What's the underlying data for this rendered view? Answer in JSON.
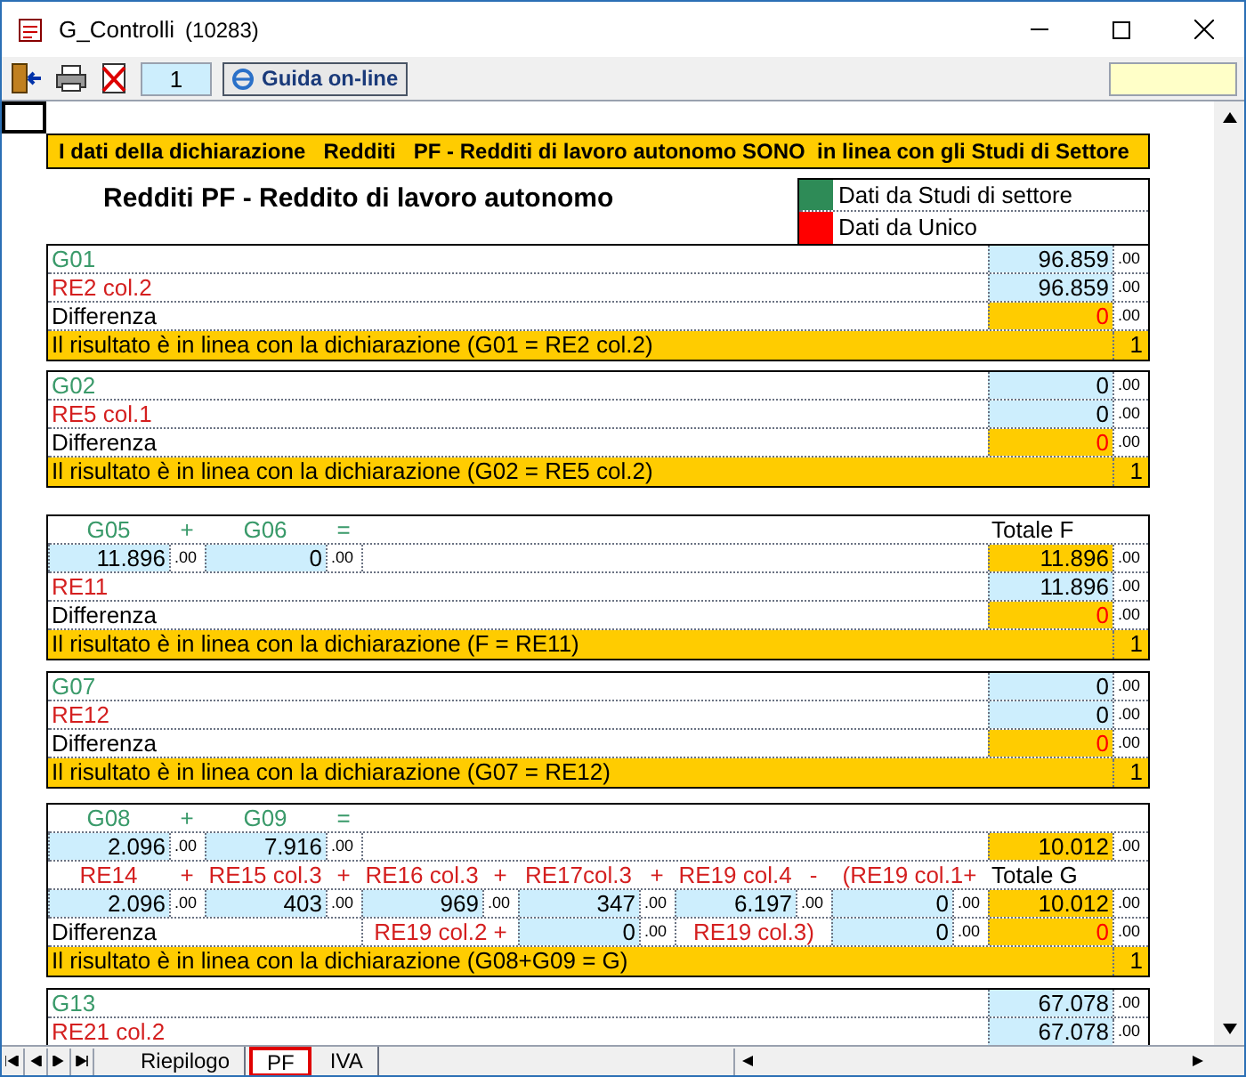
{
  "window": {
    "title": "G_Controlli",
    "code": "(10283)"
  },
  "toolbar": {
    "page_field": "1",
    "help_button": "Guida on-line"
  },
  "banner": "I dati della dichiarazione   Redditi   PF - Redditi di lavoro autonomo SONO  in linea con gli Studi di Settore",
  "heading": "Redditi PF -  Reddito di lavoro autonomo",
  "legend": [
    {
      "label": "Dati da Studi di settore",
      "color": "#2e8b57"
    },
    {
      "label": "Dati da Unico",
      "color": "#ff0000"
    }
  ],
  "blocks": [
    {
      "rows": [
        {
          "kind": "line",
          "label": "G01",
          "color": "#3a9a6a",
          "value": {
            "v": "96.859",
            "d": ".00",
            "computed": false
          }
        },
        {
          "kind": "line",
          "label": "RE2 col.2",
          "color": "#d41f1f",
          "value": {
            "v": "96.859",
            "d": ".00",
            "computed": false
          }
        },
        {
          "kind": "difference",
          "label": "Differenza",
          "value": {
            "v": "0",
            "d": ".00",
            "computed": true
          }
        },
        {
          "kind": "result",
          "text": "Il risultato è in linea con la dichiarazione (G01 = RE2 col.2)",
          "flag": "1"
        }
      ]
    },
    {
      "rows": [
        {
          "kind": "line",
          "label": "G02",
          "color": "#3a9a6a",
          "value": {
            "v": "0",
            "d": ".00",
            "computed": false
          }
        },
        {
          "kind": "line",
          "label": "RE5 col.1",
          "color": "#d41f1f",
          "value": {
            "v": "0",
            "d": ".00",
            "computed": false
          }
        },
        {
          "kind": "difference",
          "label": "Differenza",
          "value": {
            "v": "0",
            "d": ".00",
            "computed": true
          }
        },
        {
          "kind": "result",
          "text": "Il risultato è in linea con la dichiarazione (G02 = RE5 col.2)",
          "flag": "1"
        }
      ]
    },
    {
      "rows": [
        {
          "kind": "terms",
          "color": "#3a9a6a",
          "items": [
            "G05",
            "+",
            "G06",
            "="
          ],
          "total_label": "Totale F"
        },
        {
          "kind": "values",
          "cells": [
            {
              "v": "11.896",
              "d": ".00",
              "computed": false
            },
            {
              "v": "0",
              "d": ".00",
              "computed": false
            }
          ],
          "total": {
            "v": "11.896",
            "d": ".00",
            "computed": true
          }
        },
        {
          "kind": "line",
          "label": "RE11",
          "color": "#d41f1f",
          "value": {
            "v": "11.896",
            "d": ".00",
            "computed": false
          }
        },
        {
          "kind": "difference",
          "label": "Differenza",
          "value": {
            "v": "0",
            "d": ".00",
            "computed": true
          }
        },
        {
          "kind": "result",
          "text": "Il risultato è in linea con la dichiarazione (F = RE11)",
          "flag": "1"
        }
      ]
    },
    {
      "rows": [
        {
          "kind": "line",
          "label": "G07",
          "color": "#3a9a6a",
          "value": {
            "v": "0",
            "d": ".00",
            "computed": false
          }
        },
        {
          "kind": "line",
          "label": "RE12",
          "color": "#d41f1f",
          "value": {
            "v": "0",
            "d": ".00",
            "computed": false
          }
        },
        {
          "kind": "difference",
          "label": "Differenza",
          "value": {
            "v": "0",
            "d": ".00",
            "computed": true
          }
        },
        {
          "kind": "result",
          "text": "Il risultato è in linea con la dichiarazione (G07 = RE12)",
          "flag": "1"
        }
      ]
    },
    {
      "rows": [
        {
          "kind": "terms",
          "color": "#3a9a6a",
          "items": [
            "G08",
            "+",
            "G09",
            "="
          ]
        },
        {
          "kind": "values",
          "cells": [
            {
              "v": "2.096",
              "d": ".00",
              "computed": false
            },
            {
              "v": "7.916",
              "d": ".00",
              "computed": false
            }
          ],
          "total": {
            "v": "10.012",
            "d": ".00",
            "computed": true
          }
        },
        {
          "kind": "terms",
          "color": "#d41f1f",
          "items": [
            "RE14",
            "+",
            "RE15 col.3",
            "+",
            "RE16 col.3",
            "+",
            "RE17col.3",
            "+",
            "RE19 col.4",
            "-",
            "(RE19 col.1+"
          ],
          "total_label": "Totale G"
        },
        {
          "kind": "values",
          "cells": [
            {
              "v": "2.096",
              "d": ".00",
              "computed": false
            },
            {
              "v": "403",
              "d": ".00",
              "computed": false
            },
            {
              "v": "969",
              "d": ".00",
              "computed": false
            },
            {
              "v": "347",
              "d": ".00",
              "computed": false
            },
            {
              "v": "6.197",
              "d": ".00",
              "computed": false
            },
            {
              "v": "0",
              "d": ".00",
              "computed": false
            }
          ],
          "total": {
            "v": "10.012",
            "d": ".00",
            "computed": true
          }
        },
        {
          "kind": "difference",
          "label": "Differenza",
          "extras": [
            {
              "text": "RE19 col.2 +",
              "value": {
                "v": "0",
                "d": ".00",
                "computed": false
              }
            },
            {
              "text": "RE19 col.3)",
              "value": {
                "v": "0",
                "d": ".00",
                "computed": false
              }
            }
          ],
          "value": {
            "v": "0",
            "d": ".00",
            "computed": true
          }
        },
        {
          "kind": "result",
          "text": "Il risultato è in linea con la dichiarazione (G08+G09 = G)",
          "flag": "1"
        }
      ]
    },
    {
      "rows": [
        {
          "kind": "line",
          "label": "G13",
          "color": "#3a9a6a",
          "value": {
            "v": "67.078",
            "d": ".00",
            "computed": false
          }
        },
        {
          "kind": "line",
          "label": "RE21 col.2",
          "color": "#d41f1f",
          "value": {
            "v": "67.078",
            "d": ".00",
            "computed": false
          }
        }
      ]
    }
  ],
  "sheet_tabs": [
    {
      "label": "Riepilogo",
      "selected": false
    },
    {
      "label": "PF",
      "selected": true
    },
    {
      "label": "IVA",
      "selected": false
    }
  ]
}
